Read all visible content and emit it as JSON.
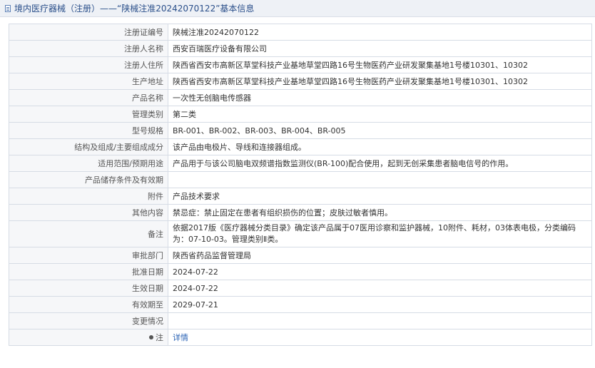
{
  "header": {
    "title": "境内医疗器械（注册）——“陕械注准20242070122”基本信息",
    "icon": "document-icon"
  },
  "rows": [
    {
      "label": "注册证编号",
      "value": "陕械注准20242070122"
    },
    {
      "label": "注册人名称",
      "value": "西安百瑞医疗设备有限公司"
    },
    {
      "label": "注册人住所",
      "value": "陕西省西安市高新区草堂科技产业基地草堂四路16号生物医药产业研发聚集基地1号楼10301、10302"
    },
    {
      "label": "生产地址",
      "value": "陕西省西安市高新区草堂科技产业基地草堂四路16号生物医药产业研发聚集基地1号楼10301、10302"
    },
    {
      "label": "产品名称",
      "value": "一次性无创脑电传感器"
    },
    {
      "label": "管理类别",
      "value": "第二类"
    },
    {
      "label": "型号规格",
      "value": "BR-001、BR-002、BR-003、BR-004、BR-005"
    },
    {
      "label": "结构及组成/主要组成成分",
      "value": "该产品由电极片、导线和连接器组成。"
    },
    {
      "label": "适用范围/预期用途",
      "value": "产品用于与该公司脑电双频谱指数监测仪(BR-100)配合使用，起到无创采集患者脑电信号的作用。"
    },
    {
      "label": "产品储存条件及有效期",
      "value": ""
    },
    {
      "label": "附件",
      "value": "产品技术要求"
    },
    {
      "label": "其他内容",
      "value": "禁忌症：禁止固定在患者有组织损伤的位置；皮肤过敏者慎用。"
    },
    {
      "label": "备注",
      "value": "依据2017版《医疗器械分类目录》确定该产品属于07医用诊察和监护器械，10附件、耗材，03体表电极，分类编码为：07-10-03。管理类别Ⅱ类。"
    },
    {
      "label": "审批部门",
      "value": "陕西省药品监督管理局"
    },
    {
      "label": "批准日期",
      "value": "2024-07-22"
    },
    {
      "label": "生效日期",
      "value": "2024-07-22"
    },
    {
      "label": "有效期至",
      "value": "2029-07-21"
    },
    {
      "label": "变更情况",
      "value": ""
    }
  ],
  "note_row": {
    "label": "注",
    "icon": "bullet-icon",
    "link_text": "详情"
  }
}
